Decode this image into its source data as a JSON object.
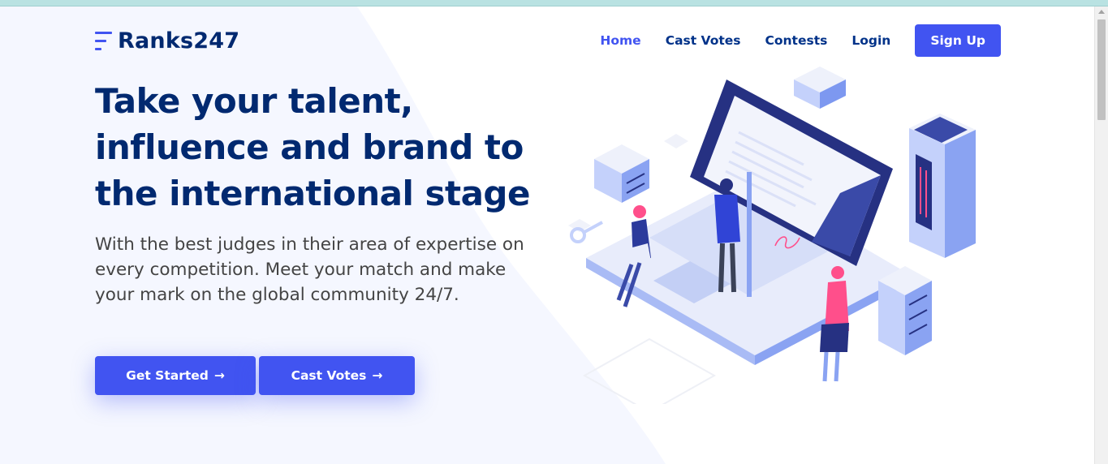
{
  "brand": {
    "name": "Ranks247"
  },
  "nav": {
    "items": [
      {
        "label": "Home",
        "active": true
      },
      {
        "label": "Cast Votes",
        "active": false
      },
      {
        "label": "Contests",
        "active": false
      },
      {
        "label": "Login",
        "active": false
      }
    ],
    "signup_label": "Sign Up"
  },
  "hero": {
    "headline_lines": [
      "Take your talent,",
      "influence and brand to",
      "the international stage"
    ],
    "subtext": "With the best judges in their area of expertise on every competition. Meet your match and make your mark on the global community 24/7.",
    "buttons": {
      "get_started": "Get Started",
      "cast_votes": "Cast Votes",
      "arrow": "→"
    }
  },
  "colors": {
    "accent": "#4154f1",
    "heading": "#012970",
    "nav_text": "#013289",
    "body_text": "#444444",
    "topbar": "#b9e2e2"
  },
  "icons": [
    "logo-mark-icon",
    "arrow-right-icon",
    "scroll-up-icon"
  ]
}
